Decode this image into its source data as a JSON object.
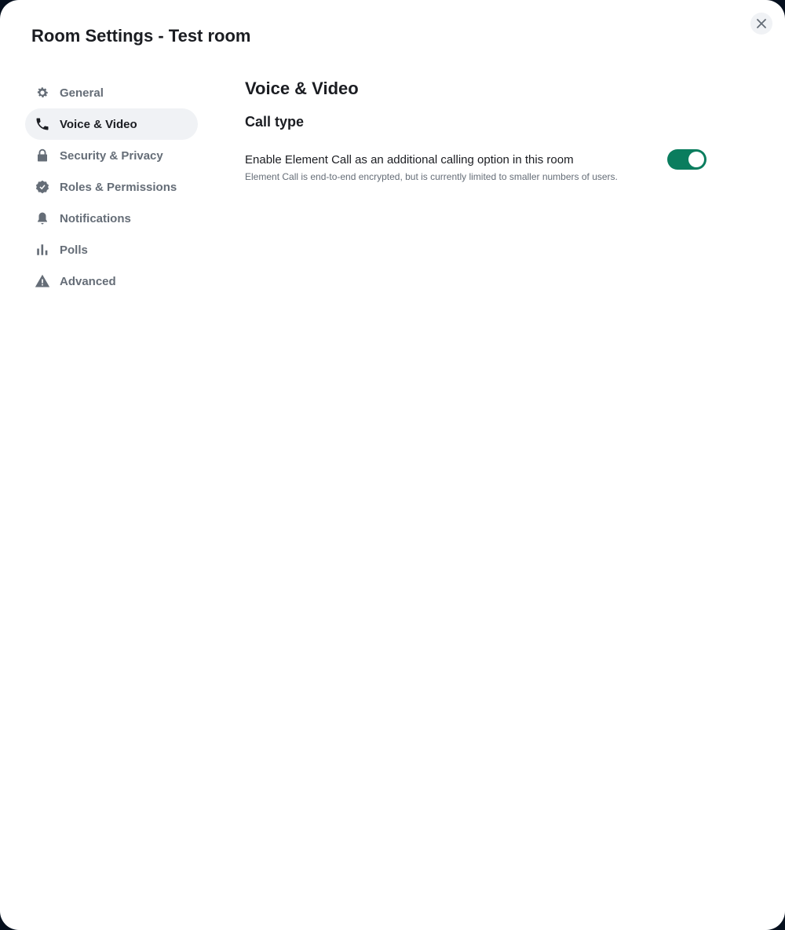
{
  "dialog": {
    "title": "Room Settings - Test room",
    "close_icon": "close-icon"
  },
  "sidebar": {
    "items": [
      {
        "label": "General",
        "icon": "gear-icon"
      },
      {
        "label": "Voice & Video",
        "icon": "phone-icon",
        "active": true
      },
      {
        "label": "Security & Privacy",
        "icon": "lock-icon"
      },
      {
        "label": "Roles & Permissions",
        "icon": "badge-check-icon"
      },
      {
        "label": "Notifications",
        "icon": "bell-icon"
      },
      {
        "label": "Polls",
        "icon": "chart-icon"
      },
      {
        "label": "Advanced",
        "icon": "warning-icon"
      }
    ]
  },
  "main": {
    "heading": "Voice & Video",
    "section": "Call type",
    "setting": {
      "label": "Enable Element Call as an additional calling option in this room",
      "description": "Element Call is end-to-end encrypted, but is currently limited to smaller numbers of users.",
      "enabled": true
    }
  },
  "colors": {
    "accent": "#0a7d5e",
    "muted": "#656d77",
    "text": "#1b1d22"
  }
}
